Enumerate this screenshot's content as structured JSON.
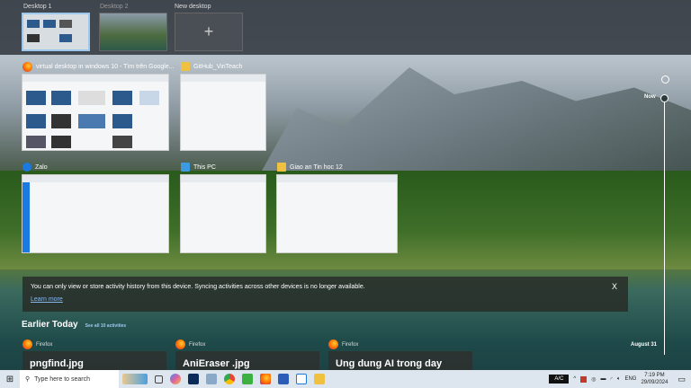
{
  "desktops": [
    {
      "label": "Desktop 1"
    },
    {
      "label": "Desktop 2"
    },
    {
      "label": "New desktop",
      "icon": "plus-icon"
    }
  ],
  "windows": [
    {
      "title": "virtual desktop in windows 10 - Tìm trên Google...",
      "icon": "firefox-icon"
    },
    {
      "title": "GitHub_ViriTeach",
      "icon": "folder-icon"
    },
    {
      "title": "Zalo",
      "icon": "zalo-icon"
    },
    {
      "title": "This PC",
      "icon": "this-pc-icon"
    },
    {
      "title": "Giao an Tin hoc 12",
      "icon": "folder-icon"
    }
  ],
  "timeline": {
    "now": "Now",
    "date": "August 31"
  },
  "notification": {
    "text": "You can only view or store activity history from this device. Syncing activities across other devices is no longer available.",
    "link": "Learn more",
    "close": "X"
  },
  "activities": {
    "heading": "Earlier Today",
    "see_all": "See all 10 activities",
    "cards": [
      {
        "app": "Firefox",
        "title": "pngfind.jpg"
      },
      {
        "app": "Firefox",
        "title": "AniEraser .jpg"
      },
      {
        "app": "Firefox",
        "title": "Ung dung AI trong day"
      }
    ]
  },
  "taskbar": {
    "search_placeholder": "Type here to search",
    "ac": "A/C",
    "lang": "ENG",
    "time": "7:19 PM",
    "date": "29/09/2024"
  }
}
